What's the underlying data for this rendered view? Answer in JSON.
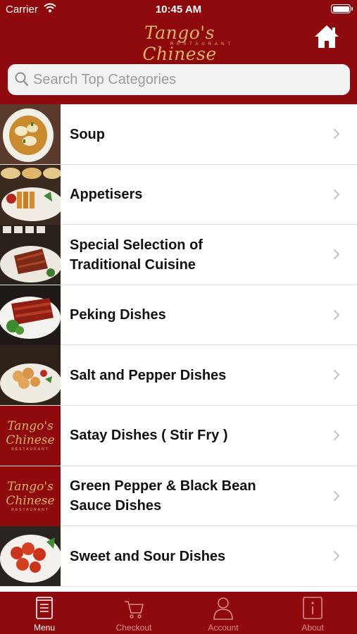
{
  "status_bar": {
    "carrier": "Carrier",
    "time": "10:45 AM"
  },
  "header": {
    "logo_text": "Tango's Chinese",
    "logo_subtext": "RESTAURANT",
    "home_icon": "home-icon"
  },
  "search": {
    "placeholder": "Search Top Categories",
    "value": ""
  },
  "categories": [
    {
      "label": "Soup",
      "thumb": "photo"
    },
    {
      "label": "Appetisers",
      "thumb": "photo"
    },
    {
      "label": "Special Selection of\nTraditional Cuisine",
      "thumb": "photo"
    },
    {
      "label": "Peking Dishes",
      "thumb": "photo"
    },
    {
      "label": "Salt and Pepper Dishes",
      "thumb": "photo"
    },
    {
      "label": "Satay Dishes ( Stir Fry )",
      "thumb": "logo"
    },
    {
      "label": "Green Pepper & Black Bean\nSauce Dishes",
      "thumb": "logo"
    },
    {
      "label": "Sweet and Sour Dishes",
      "thumb": "photo"
    }
  ],
  "tabs": [
    {
      "label": "Menu",
      "icon": "menu-book-icon",
      "active": true
    },
    {
      "label": "Checkout",
      "icon": "cart-icon",
      "active": false
    },
    {
      "label": "Account",
      "icon": "person-icon",
      "active": false
    },
    {
      "label": "About",
      "icon": "info-icon",
      "active": false
    }
  ],
  "colors": {
    "brand_red": "#8e0a0d",
    "logo_gold": "#d9b46c",
    "inactive_tab": "#d98a88"
  }
}
